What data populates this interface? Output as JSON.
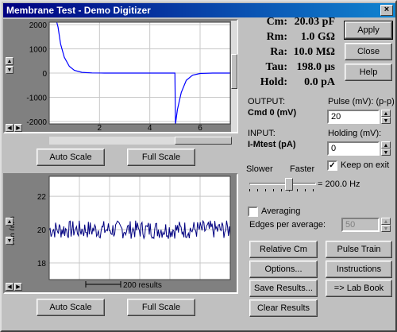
{
  "window": {
    "title": "Membrane Test - Demo Digitizer",
    "close_glyph": "×"
  },
  "measurements": [
    {
      "name": "Cm:",
      "value": "20.03 pF"
    },
    {
      "name": "Rm:",
      "value": "1.0 GΩ"
    },
    {
      "name": "Ra:",
      "value": "10.0 MΩ"
    },
    {
      "name": "Tau:",
      "value": "198.0 µs"
    },
    {
      "name": "Hold:",
      "value": "0.0 pA"
    }
  ],
  "buttons": {
    "apply": "Apply",
    "close": "Close",
    "help": "Help",
    "auto_scale_top": "Auto Scale",
    "full_scale_top": "Full Scale",
    "auto_scale_bottom": "Auto Scale",
    "full_scale_bottom": "Full Scale",
    "relative_cm": "Relative Cm",
    "pulse_train": "Pulse Train",
    "options": "Options...",
    "instructions": "Instructions",
    "save_results": "Save Results...",
    "lab_book": "=> Lab Book",
    "clear_results": "Clear Results"
  },
  "output": {
    "label": "OUTPUT:",
    "channel": "Cmd 0 (mV)"
  },
  "input": {
    "label": "INPUT:",
    "channel": "I-Mtest (pA)"
  },
  "pulse": {
    "label": "Pulse (mV): (p-p)",
    "value": "20"
  },
  "holding": {
    "label": "Holding (mV):",
    "value": "0"
  },
  "keep_on_exit": {
    "label": "Keep on exit",
    "checked": true
  },
  "rate": {
    "slower": "Slower",
    "faster": "Faster",
    "value": "= 200.0 Hz",
    "level": 0.6
  },
  "averaging": {
    "label": "Averaging",
    "checked": false,
    "edges_label": "Edges per average:",
    "edges_value": "50"
  },
  "chart_data": [
    {
      "type": "line",
      "title": "",
      "ylim": [
        -2100,
        2100
      ],
      "xlim": [
        0,
        7.2
      ],
      "yticks": [
        "2000",
        "1000",
        "0",
        "-1000",
        "-2000"
      ],
      "xticks": [
        "2",
        "4",
        "6"
      ],
      "grid": true,
      "series": [
        {
          "x": [
            0.3,
            0.35,
            0.45,
            0.6,
            0.8,
            1.0,
            1.3,
            1.7,
            2.2,
            3,
            4,
            5.0,
            5.02,
            5.1,
            5.25,
            5.45,
            5.7,
            6.0,
            6.5,
            7.2
          ],
          "values": [
            2100,
            1900,
            1200,
            650,
            280,
            110,
            30,
            5,
            0,
            0,
            0,
            0,
            -2100,
            -1500,
            -800,
            -300,
            -90,
            -15,
            0,
            0
          ],
          "color": "#0000ff"
        }
      ]
    },
    {
      "type": "line",
      "ylabel": "Cm (pF)",
      "ylim": [
        17,
        23.2
      ],
      "yticks": [
        "22",
        "20",
        "18"
      ],
      "grid": true,
      "annotation": "200 results",
      "series": [
        {
          "mean": 20,
          "noise": 0.55,
          "points": 200,
          "color": "#000080"
        }
      ]
    }
  ]
}
